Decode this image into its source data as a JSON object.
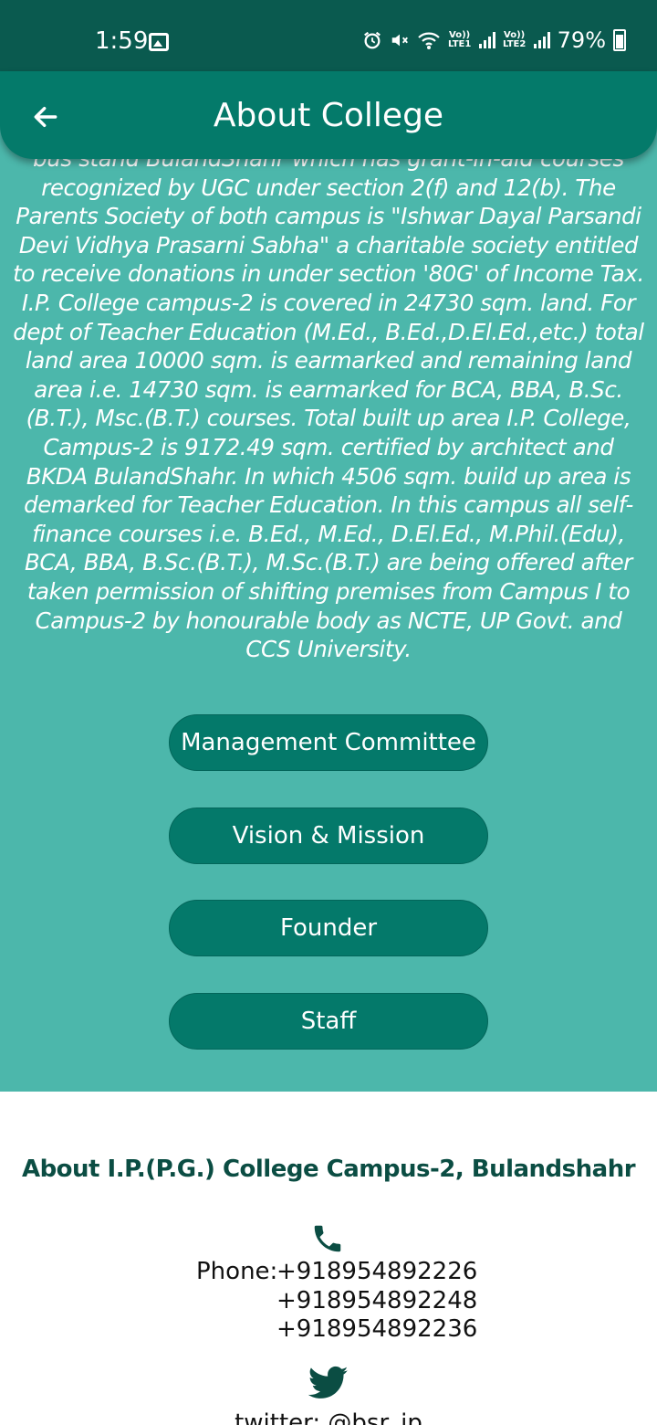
{
  "status_bar": {
    "time": "1:59",
    "battery": "79%",
    "sim1_label": "Vo)) LTE1",
    "sim2_label": "Vo)) LTE2"
  },
  "app_bar": {
    "title": "About College",
    "back_icon": "arrow-left-icon"
  },
  "about": {
    "clipped_first_line": "bus stand BulandShahr which has grant-in-aid courses",
    "body": "recognized by UGC under section 2(f) and 12(b). The Parents Society of both campus is \"Ishwar Dayal Parsandi Devi Vidhya Prasarni Sabha\" a charitable society entitled to receive donations in under section '80G' of Income Tax. I.P. College campus-2 is covered in 24730 sqm. land. For dept of Teacher Education (M.Ed., B.Ed.,D.El.Ed.,etc.) total land area 10000 sqm. is earmarked and remaining land area i.e. 14730 sqm. is earmarked for BCA, BBA, B.Sc.(B.T.), Msc.(B.T.) courses. Total built up area I.P. College, Campus-2 is 9172.49 sqm. certified by architect and BKDA BulandShahr. In which 4506 sqm. build up area is demarked for Teacher Education. In this campus all self-finance courses i.e. B.Ed., M.Ed., D.El.Ed., M.Phil.(Edu), BCA, BBA, B.Sc.(B.T.), M.Sc.(B.T.) are being offered after taken permission of shifting premises from Campus I to Campus-2 by honourable body as NCTE, UP Govt. and CCS University."
  },
  "buttons": {
    "management": "Management Committee",
    "vision": "Vision & Mission",
    "founder": "Founder",
    "staff": "Staff"
  },
  "footer": {
    "title": "About I.P.(P.G.) College Campus-2, Bulandshahr",
    "phone_label": "Phone:",
    "phones": [
      "+918954892226",
      "+918954892248",
      "+918954892236"
    ],
    "twitter_text": "twitter: @bsr_ip"
  },
  "colors": {
    "status_bar": "#0a5a4f",
    "app_bar": "#047a6a",
    "teal_background": "#4cb7ab",
    "button": "#04796a",
    "footer_title": "#0b4d43"
  },
  "icons": [
    "image-icon",
    "alarm-icon",
    "mute-icon",
    "wifi-icon",
    "signal-icon",
    "battery-icon",
    "arrow-left-icon",
    "phone-icon",
    "twitter-icon"
  ]
}
